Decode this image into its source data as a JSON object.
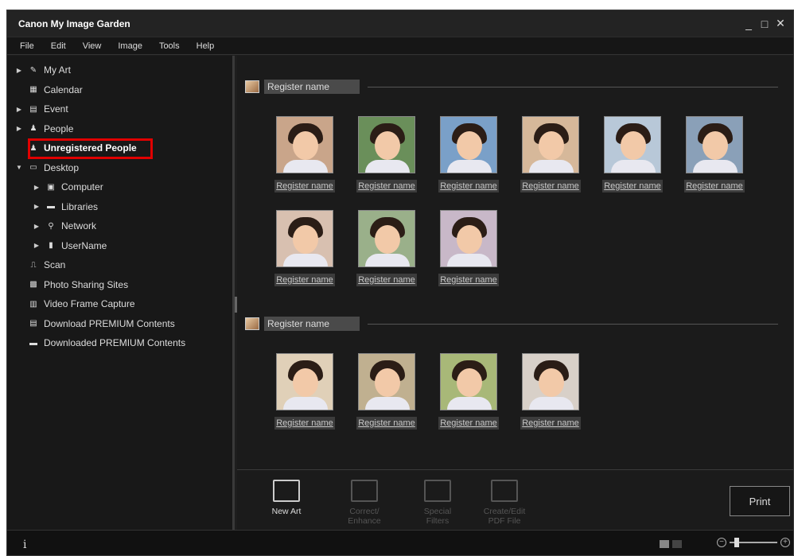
{
  "window": {
    "title": "Canon My Image Garden",
    "controls": [
      "_",
      "□",
      "✕"
    ]
  },
  "menu": [
    "File",
    "Edit",
    "View",
    "Image",
    "Tools",
    "Help"
  ],
  "sidebar": {
    "items": [
      {
        "label": "My Art",
        "icon": "art-icon",
        "level": 0,
        "expandable": true
      },
      {
        "label": "Calendar",
        "icon": "calendar-icon",
        "level": 0,
        "expandable": false
      },
      {
        "label": "Event",
        "icon": "event-icon",
        "level": 0,
        "expandable": true
      },
      {
        "label": "People",
        "icon": "people-icon",
        "level": 0,
        "expandable": true
      },
      {
        "label": "Unregistered People",
        "icon": "unregistered-person-icon",
        "level": 0,
        "expandable": false,
        "selected": true
      },
      {
        "label": "Desktop",
        "icon": "desktop-icon",
        "level": 0,
        "expandable": true,
        "expanded": true
      },
      {
        "label": "Computer",
        "icon": "computer-icon",
        "level": 1,
        "expandable": true
      },
      {
        "label": "Libraries",
        "icon": "libraries-icon",
        "level": 1,
        "expandable": true
      },
      {
        "label": "Network",
        "icon": "network-icon",
        "level": 1,
        "expandable": true
      },
      {
        "label": "UserName",
        "icon": "user-folder-icon",
        "level": 1,
        "expandable": true
      },
      {
        "label": "Scan",
        "icon": "scan-icon",
        "level": 0,
        "expandable": false
      },
      {
        "label": "Photo Sharing Sites",
        "icon": "photo-sharing-icon",
        "level": 0,
        "expandable": false
      },
      {
        "label": "Video Frame Capture",
        "icon": "video-frame-icon",
        "level": 0,
        "expandable": false
      },
      {
        "label": "Download PREMIUM Contents",
        "icon": "download-premium-icon",
        "level": 0,
        "expandable": false
      },
      {
        "label": "Downloaded PREMIUM Contents",
        "icon": "downloaded-premium-icon",
        "level": 0,
        "expandable": false
      }
    ]
  },
  "groups": [
    {
      "label": "Register name",
      "thumbs": [
        "Register name",
        "Register name",
        "Register name",
        "Register name",
        "Register name",
        "Register name",
        "Register name",
        "Register name",
        "Register name"
      ]
    },
    {
      "label": "Register name",
      "thumbs": [
        "Register name",
        "Register name",
        "Register name",
        "Register name"
      ]
    }
  ],
  "toolbar": {
    "new_art": "New Art",
    "correct": "Correct/\nEnhance",
    "filters": "Special\nFilters",
    "pdf": "Create/Edit\nPDF File",
    "print": "Print"
  },
  "status": {
    "info": "i"
  }
}
